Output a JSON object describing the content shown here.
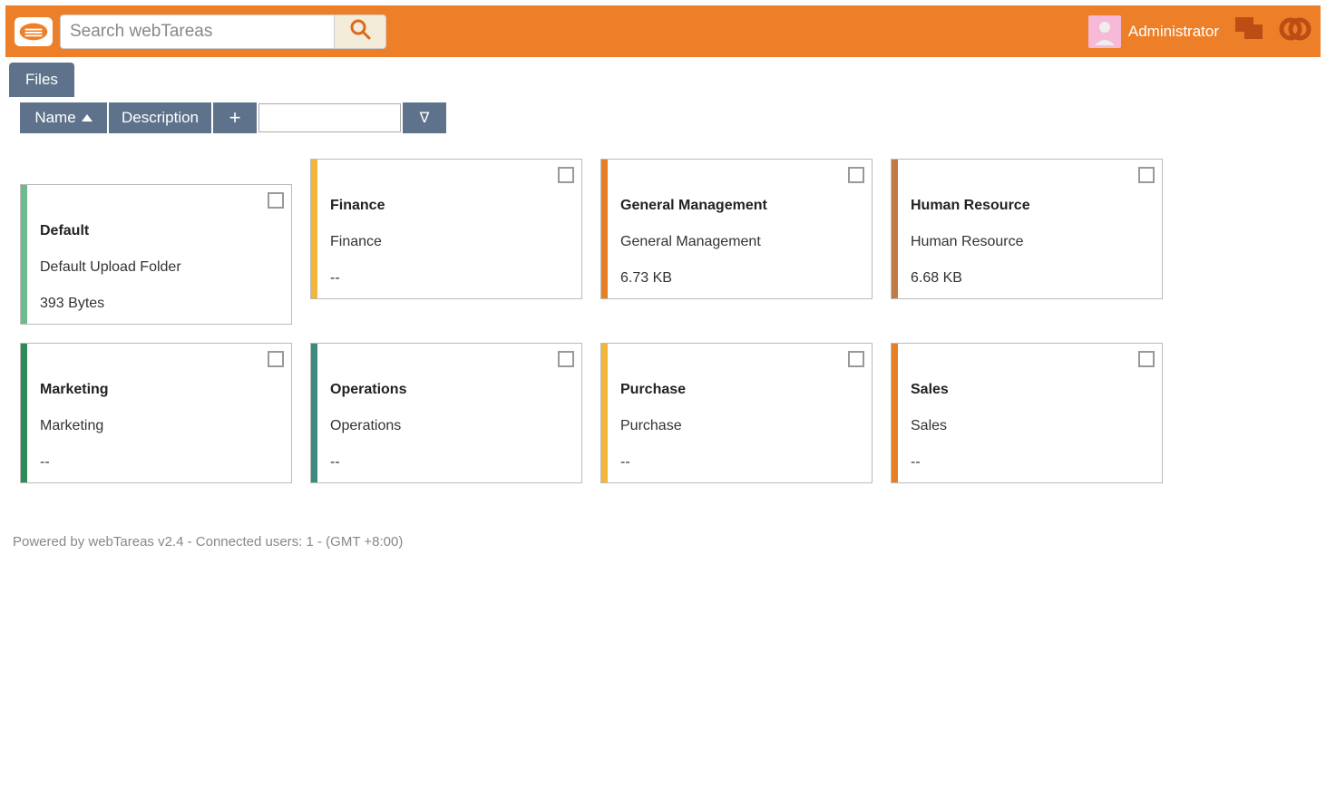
{
  "header": {
    "search_placeholder": "Search webTareas",
    "username": "Administrator"
  },
  "tabs": {
    "files": "Files"
  },
  "toolbar": {
    "name_label": "Name",
    "description_label": "Description",
    "plus_label": "+",
    "filter_label": "∇"
  },
  "folders": [
    {
      "title": "Default",
      "desc": "Default Upload Folder",
      "size": "393 Bytes",
      "color": "c-green",
      "special": true
    },
    {
      "title": "Finance",
      "desc": "Finance",
      "size": "--",
      "color": "c-yellow"
    },
    {
      "title": "General Management",
      "desc": "General Management",
      "size": "6.73 KB",
      "color": "c-orange"
    },
    {
      "title": "Human Resource",
      "desc": "Human Resource",
      "size": "6.68 KB",
      "color": "c-brown"
    },
    {
      "title": "Marketing",
      "desc": "Marketing",
      "size": "--",
      "color": "c-dgreen"
    },
    {
      "title": "Operations",
      "desc": "Operations",
      "size": "--",
      "color": "c-dteal"
    },
    {
      "title": "Purchase",
      "desc": "Purchase",
      "size": "--",
      "color": "c-yellow2"
    },
    {
      "title": "Sales",
      "desc": "Sales",
      "size": "--",
      "color": "c-orange2"
    }
  ],
  "footer": {
    "text": "Powered by webTareas v2.4 - Connected users: 1 - (GMT +8:00)"
  }
}
